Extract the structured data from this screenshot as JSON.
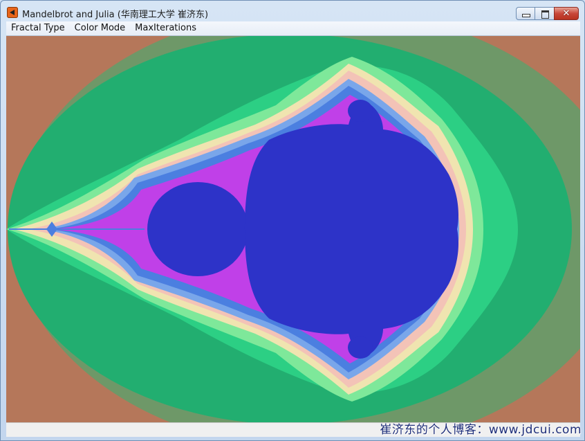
{
  "window": {
    "title": "Mandelbrot and Julia (华南理工大学 崔济东)",
    "icon": "app-icon"
  },
  "caption_buttons": {
    "minimize_icon": "minimize-icon",
    "maximize_icon": "maximize-icon",
    "close_icon": "close-icon",
    "close_glyph": "✕"
  },
  "menu": {
    "items": [
      "Fractal Type",
      "Color Mode",
      "MaxIterations"
    ]
  },
  "canvas": {
    "colors": {
      "outer": "#b5775a",
      "band1": "#6e9868",
      "band2": "#22ae70",
      "band3": "#2ccf84",
      "band4": "#7ee89a",
      "band5": "#f0e4b0",
      "band6": "#f3c3b7",
      "band7": "#79a6ea",
      "band8": "#4b7fe0",
      "edge": "#c040e8",
      "set": "#2d33c8"
    }
  },
  "watermark": {
    "text": "崔济东的个人博客：www.jdcui.com"
  }
}
